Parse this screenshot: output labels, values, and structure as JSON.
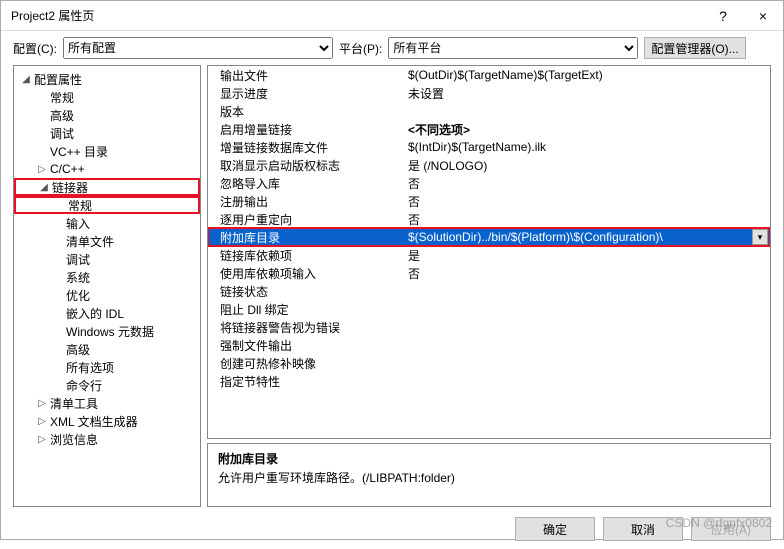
{
  "window": {
    "title": "Project2 属性页",
    "help": "?",
    "close": "×"
  },
  "toolbar": {
    "config_label": "配置(C):",
    "config_value": "所有配置",
    "platform_label": "平台(P):",
    "platform_value": "所有平台",
    "config_mgr": "配置管理器(O)..."
  },
  "tree": [
    {
      "label": "配置属性",
      "indent": 0,
      "exp": "◢"
    },
    {
      "label": "常规",
      "indent": 1,
      "exp": ""
    },
    {
      "label": "高级",
      "indent": 1,
      "exp": ""
    },
    {
      "label": "调试",
      "indent": 1,
      "exp": ""
    },
    {
      "label": "VC++ 目录",
      "indent": 1,
      "exp": ""
    },
    {
      "label": "C/C++",
      "indent": 1,
      "exp": "▷"
    },
    {
      "label": "链接器",
      "indent": 1,
      "exp": "◢",
      "hl": true
    },
    {
      "label": "常规",
      "indent": 2,
      "exp": "",
      "hl": true,
      "selected": true
    },
    {
      "label": "输入",
      "indent": 2,
      "exp": ""
    },
    {
      "label": "清单文件",
      "indent": 2,
      "exp": ""
    },
    {
      "label": "调试",
      "indent": 2,
      "exp": ""
    },
    {
      "label": "系统",
      "indent": 2,
      "exp": ""
    },
    {
      "label": "优化",
      "indent": 2,
      "exp": ""
    },
    {
      "label": "嵌入的 IDL",
      "indent": 2,
      "exp": ""
    },
    {
      "label": "Windows 元数据",
      "indent": 2,
      "exp": ""
    },
    {
      "label": "高级",
      "indent": 2,
      "exp": ""
    },
    {
      "label": "所有选项",
      "indent": 2,
      "exp": ""
    },
    {
      "label": "命令行",
      "indent": 2,
      "exp": ""
    },
    {
      "label": "清单工具",
      "indent": 1,
      "exp": "▷"
    },
    {
      "label": "XML 文档生成器",
      "indent": 1,
      "exp": "▷"
    },
    {
      "label": "浏览信息",
      "indent": 1,
      "exp": "▷"
    }
  ],
  "grid": [
    {
      "key": "输出文件",
      "val": "$(OutDir)$(TargetName)$(TargetExt)"
    },
    {
      "key": "显示进度",
      "val": "未设置"
    },
    {
      "key": "版本",
      "val": ""
    },
    {
      "key": "启用增量链接",
      "val": "<不同选项>",
      "bold": true
    },
    {
      "key": "增量链接数据库文件",
      "val": "$(IntDir)$(TargetName).ilk"
    },
    {
      "key": "取消显示启动版权标志",
      "val": "是 (/NOLOGO)"
    },
    {
      "key": "忽略导入库",
      "val": "否"
    },
    {
      "key": "注册输出",
      "val": "否"
    },
    {
      "key": "逐用户重定向",
      "val": "否"
    },
    {
      "key": "附加库目录",
      "val": "$(SolutionDir)../bin/$(Platform)\\$(Configuration)\\",
      "selected": true
    },
    {
      "key": "链接库依赖项",
      "val": "是"
    },
    {
      "key": "使用库依赖项输入",
      "val": "否"
    },
    {
      "key": "链接状态",
      "val": ""
    },
    {
      "key": "阻止 Dll 绑定",
      "val": ""
    },
    {
      "key": "将链接器警告视为错误",
      "val": ""
    },
    {
      "key": "强制文件输出",
      "val": ""
    },
    {
      "key": "创建可热修补映像",
      "val": ""
    },
    {
      "key": "指定节特性",
      "val": ""
    }
  ],
  "desc": {
    "title": "附加库目录",
    "text": "允许用户重写环境库路径。(/LIBPATH:folder)"
  },
  "footer": {
    "ok": "确定",
    "cancel": "取消",
    "apply": "应用(A)"
  },
  "watermark": "CSDN @rfgnfx0802"
}
